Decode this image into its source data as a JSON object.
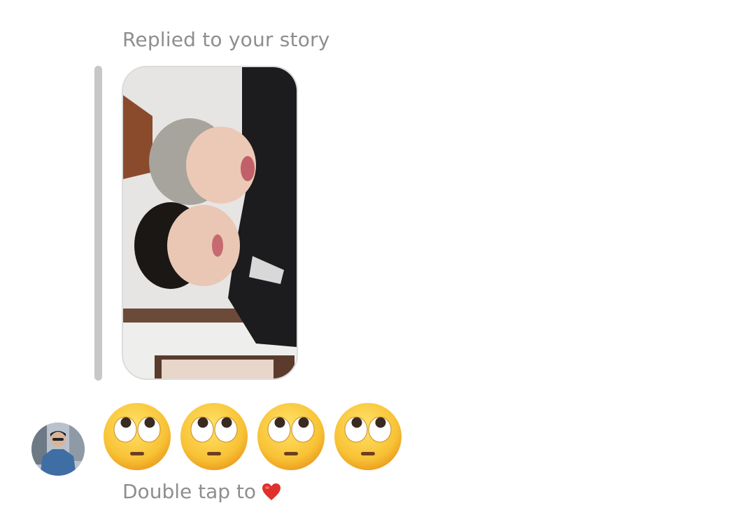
{
  "message": {
    "reply_label": "Replied to your story",
    "reaction_emoji": [
      "rolling-eyes-emoji",
      "rolling-eyes-emoji",
      "rolling-eyes-emoji",
      "rolling-eyes-emoji"
    ],
    "double_tap_text": "Double tap to",
    "double_tap_icon": "red-heart-icon"
  },
  "colors": {
    "secondary_text": "#8e8e8e",
    "reply_bar": "#c7c7c7",
    "heart": "#e0302b",
    "emoji_face": "#f8c235"
  }
}
